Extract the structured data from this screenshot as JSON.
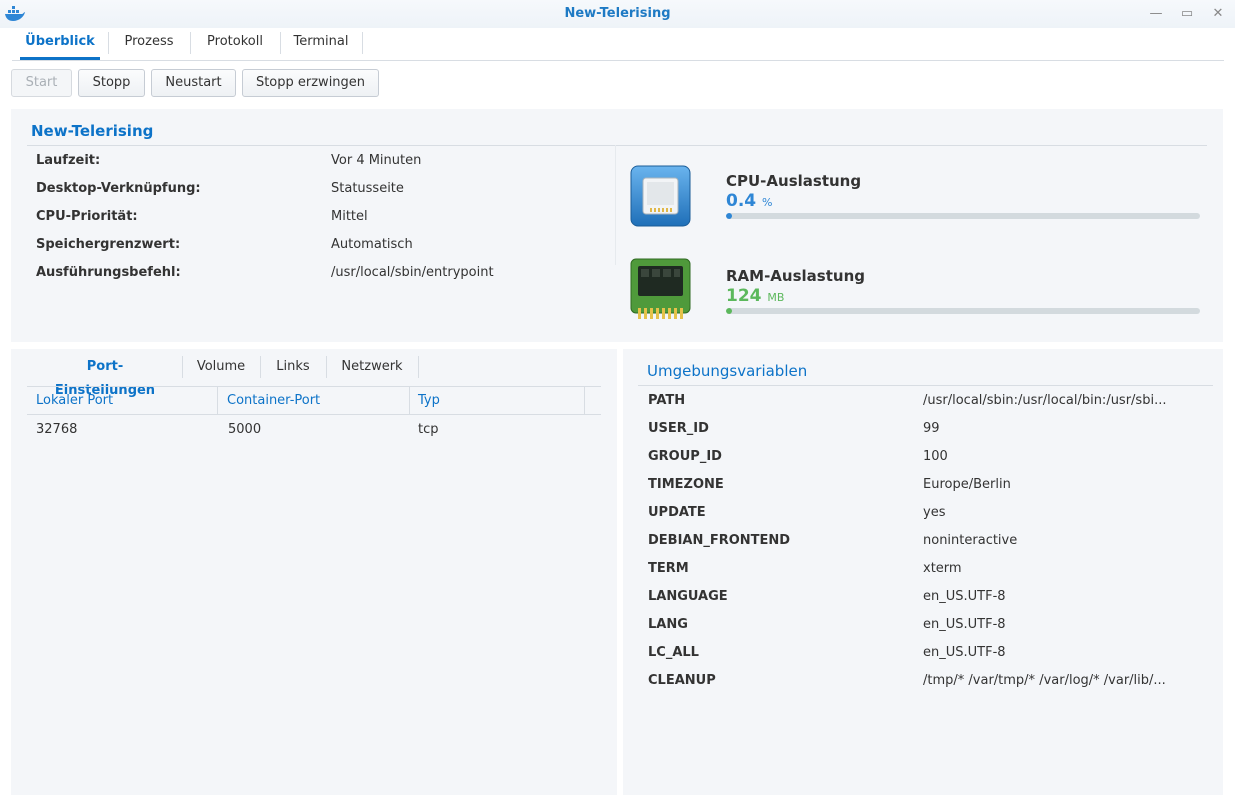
{
  "window": {
    "title": "New-Telerising",
    "minimize_glyph": "—",
    "maximize_glyph": "▭",
    "close_glyph": "✕"
  },
  "main_tabs": [
    {
      "label": "Überblick",
      "active": true
    },
    {
      "label": "Prozess"
    },
    {
      "label": "Protokoll"
    },
    {
      "label": "Terminal"
    }
  ],
  "toolbar": {
    "start_label": "Start",
    "stop_label": "Stopp",
    "restart_label": "Neustart",
    "force_stop_label": "Stopp erzwingen"
  },
  "overview": {
    "title": "New-Telerising",
    "rows": [
      {
        "label": "Laufzeit:",
        "value": "Vor 4 Minuten"
      },
      {
        "label": "Desktop-Verknüpfung:",
        "value": "Statusseite"
      },
      {
        "label": "CPU-Priorität:",
        "value": "Mittel"
      },
      {
        "label": "Speichergrenzwert:",
        "value": "Automatisch"
      },
      {
        "label": "Ausführungsbefehl:",
        "value": "/usr/local/sbin/entrypoint"
      }
    ],
    "cpu": {
      "title": "CPU-Auslastung",
      "value": "0.4",
      "unit": "%",
      "fraction": 0.004,
      "color": "#2e86d5"
    },
    "ram": {
      "title": "RAM-Auslastung",
      "value": "124",
      "unit": "MB",
      "fraction": 0.012,
      "color": "#5cb85c"
    }
  },
  "sub_tabs": [
    {
      "label": "Port-Einstellungen",
      "active": true
    },
    {
      "label": "Volume"
    },
    {
      "label": "Links"
    },
    {
      "label": "Netzwerk"
    }
  ],
  "ports": {
    "columns": [
      "Lokaler Port",
      "Container-Port",
      "Typ"
    ],
    "rows": [
      [
        "32768",
        "5000",
        "tcp"
      ]
    ]
  },
  "env": {
    "title": "Umgebungsvariablen",
    "rows": [
      {
        "key": "PATH",
        "value": "/usr/local/sbin:/usr/local/bin:/usr/sbi..."
      },
      {
        "key": "USER_ID",
        "value": "99"
      },
      {
        "key": "GROUP_ID",
        "value": "100"
      },
      {
        "key": "TIMEZONE",
        "value": "Europe/Berlin"
      },
      {
        "key": "UPDATE",
        "value": "yes"
      },
      {
        "key": "DEBIAN_FRONTEND",
        "value": "noninteractive"
      },
      {
        "key": "TERM",
        "value": "xterm"
      },
      {
        "key": "LANGUAGE",
        "value": "en_US.UTF-8"
      },
      {
        "key": "LANG",
        "value": "en_US.UTF-8"
      },
      {
        "key": "LC_ALL",
        "value": "en_US.UTF-8"
      },
      {
        "key": "CLEANUP",
        "value": "/tmp/* /var/tmp/* /var/log/* /var/lib/..."
      }
    ]
  },
  "colors": {
    "accent": "#0d73c8",
    "panel_bg": "#f4f6f9"
  },
  "icons": {
    "app": "docker-whale-icon",
    "cpu": "cpu-chip-icon",
    "ram": "ram-module-icon"
  }
}
